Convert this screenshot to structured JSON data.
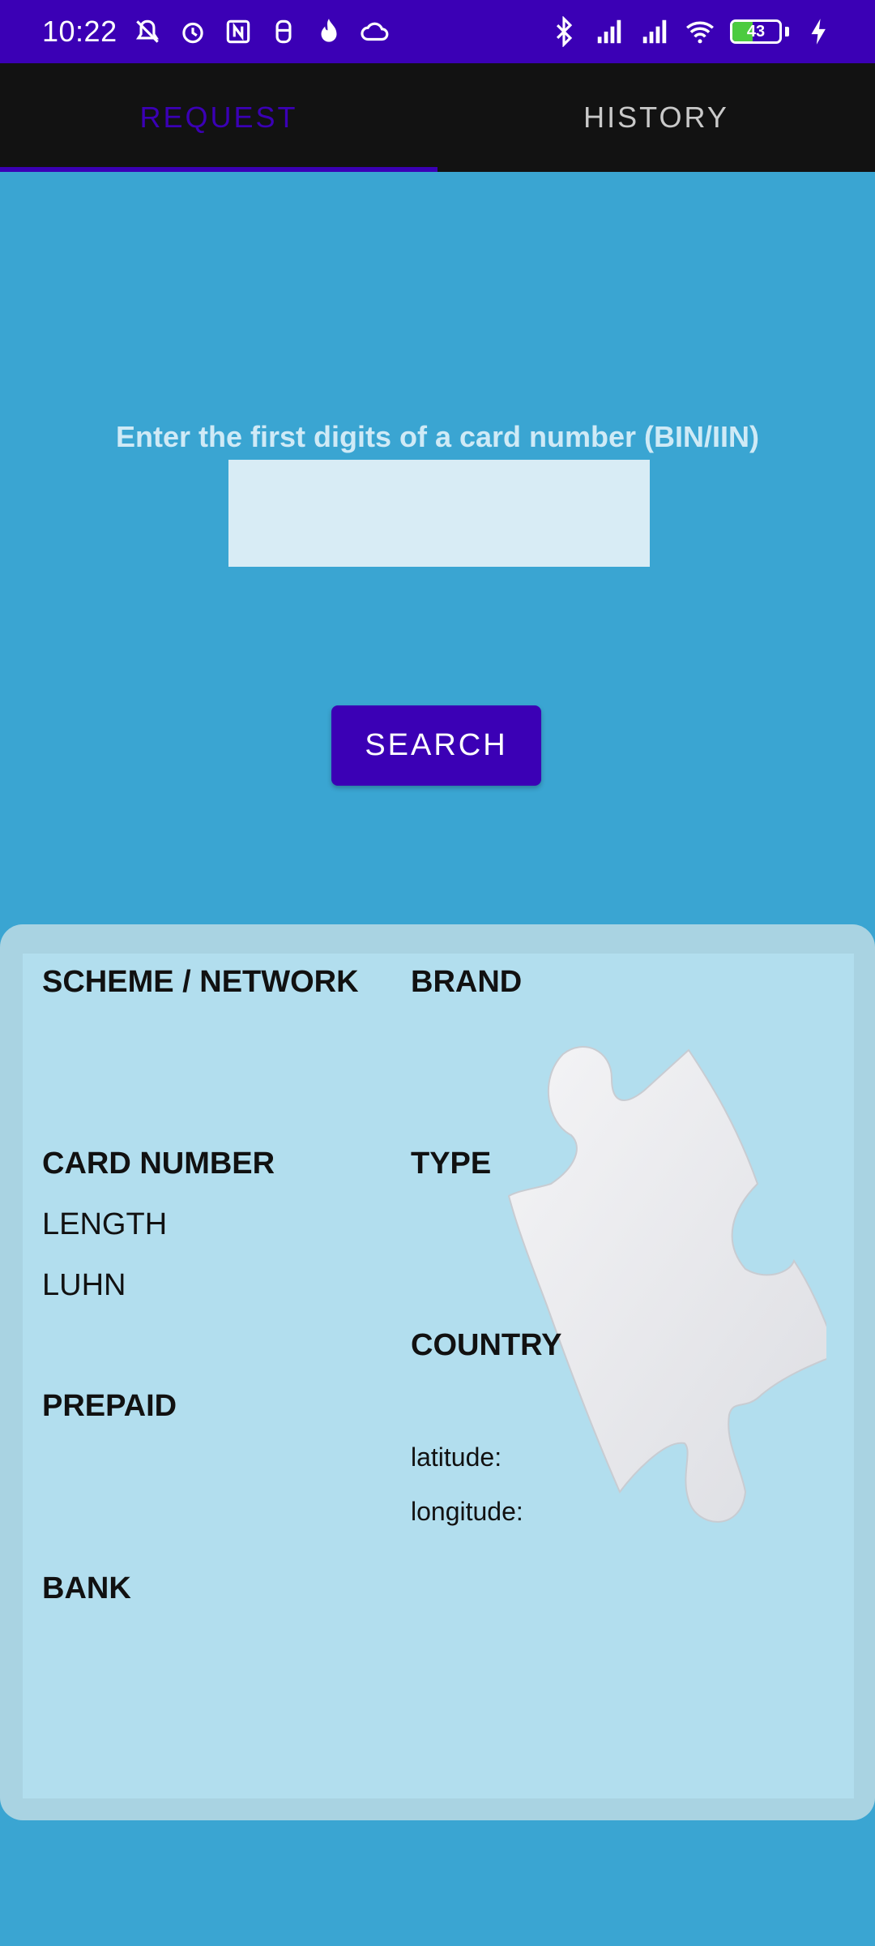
{
  "status_bar": {
    "time": "10:22",
    "battery_level": "43",
    "battery_fraction": 0.43,
    "left_icons": [
      "muted-vibrate-icon",
      "alarm-icon",
      "nfc-icon",
      "app-icon",
      "flame-icon",
      "cloud-icon"
    ],
    "right_icons": [
      "bluetooth-icon",
      "signal-icon",
      "signal-icon",
      "wifi-icon",
      "battery-icon",
      "charging-icon"
    ]
  },
  "tabs": [
    {
      "label": "REQUEST",
      "active": true
    },
    {
      "label": "HISTORY",
      "active": false
    }
  ],
  "request": {
    "prompt": "Enter the first digits of a card number (BIN/IIN)",
    "input_value": "",
    "search_label": "SEARCH"
  },
  "card": {
    "scheme_label": "SCHEME / NETWORK",
    "brand_label": "BRAND",
    "card_number_label": "CARD NUMBER",
    "type_label": "TYPE",
    "length_label": "LENGTH",
    "luhn_label": "LUHN",
    "country_label": "COUNTRY",
    "prepaid_label": "PREPAID",
    "latitude_label": "latitude:",
    "longitude_label": "longitude:",
    "bank_label": "BANK"
  },
  "colors": {
    "accent": "#3b00b5",
    "background": "#3aa5d2",
    "card": "#b2deee",
    "tabbar": "#121212"
  }
}
